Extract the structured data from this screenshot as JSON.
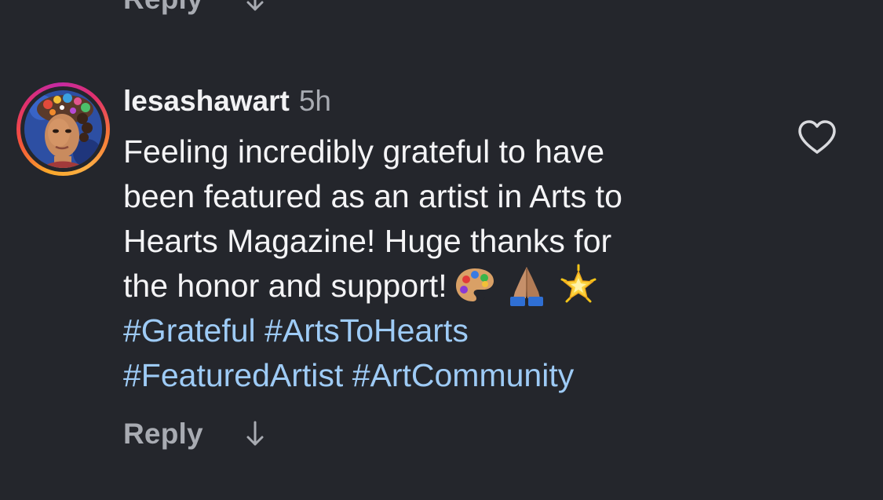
{
  "previous_comment": {
    "reply_label": "Reply",
    "view_replies_icon": "arrow-down-icon"
  },
  "comment": {
    "username": "lesashawart",
    "timestamp": "5h",
    "text_lines": [
      "Feeling incredibly grateful to have",
      "been featured as an artist in Arts to",
      "Hearts Magazine! Huge thanks for",
      "the honor and support!"
    ],
    "emojis": [
      "palette-emoji",
      "folded-hands-emoji",
      "glowing-star-emoji"
    ],
    "hashtags_line1": [
      "#Grateful",
      "#ArtsToHearts"
    ],
    "hashtags_line2": [
      "#FeaturedArtist",
      "#ArtCommunity"
    ],
    "reply_label": "Reply",
    "like_icon": "heart-outline-icon"
  },
  "colors": {
    "background": "#24262c",
    "primary_text": "#f4f4f6",
    "secondary_text": "#a8abb2",
    "hashtag": "#9ecbf6"
  }
}
